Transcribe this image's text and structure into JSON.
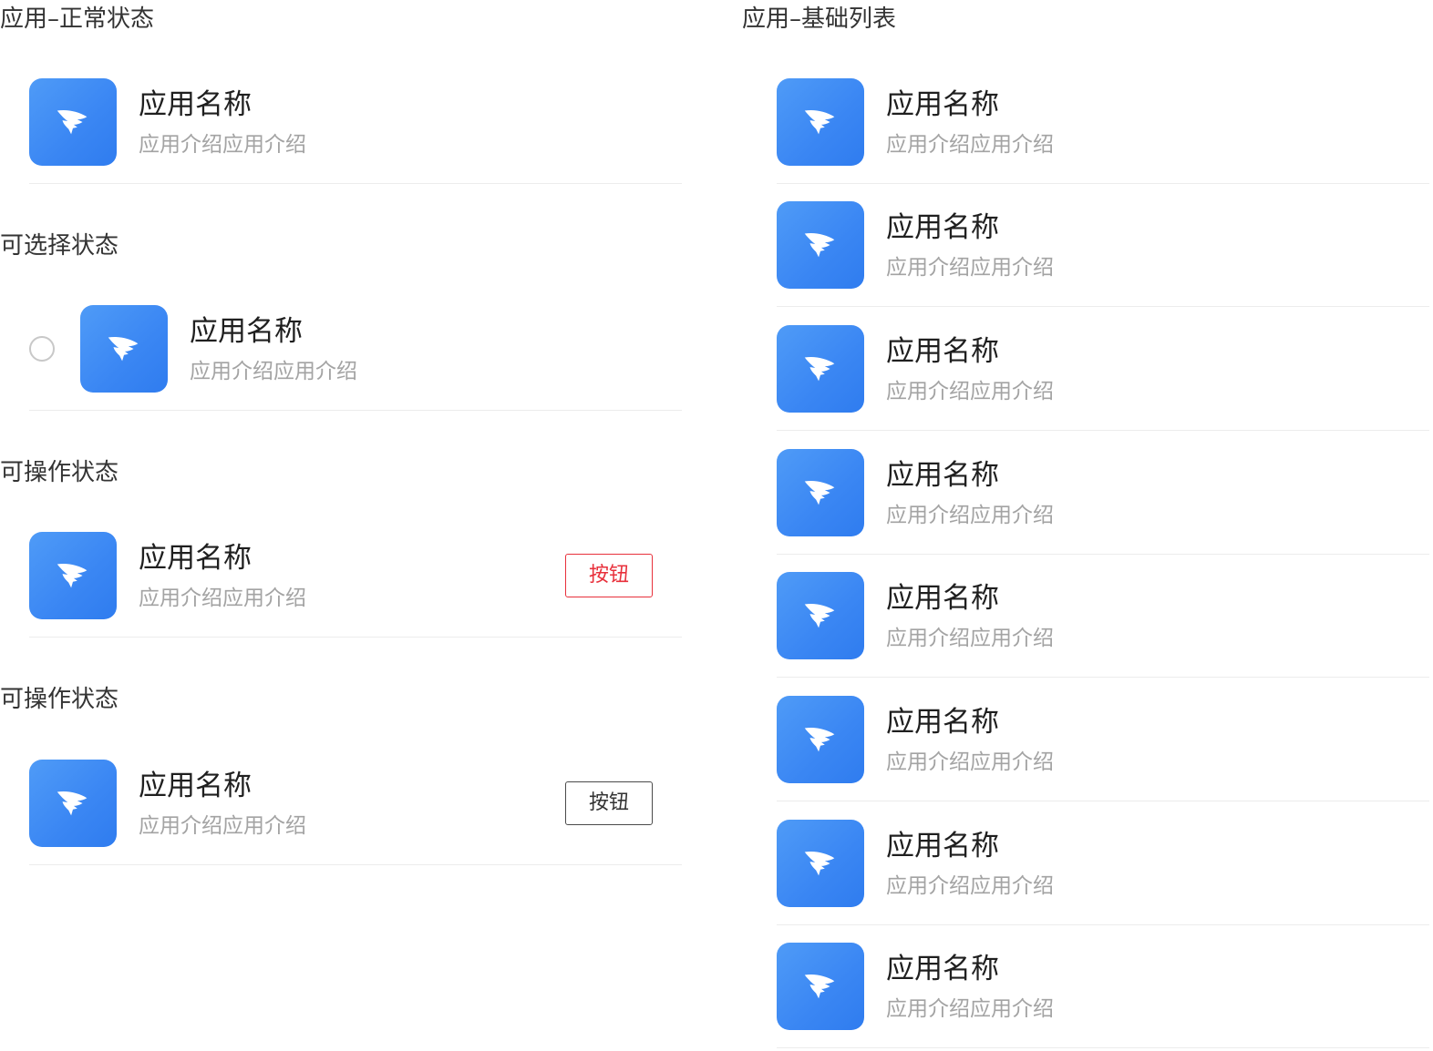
{
  "sections": {
    "normal_title": "应用–正常状态",
    "selectable_title": "可选择状态",
    "operable_red_title": "可操作状态",
    "operable_gray_title": "可操作状态",
    "basic_list_title": "应用–基础列表"
  },
  "item": {
    "name": "应用名称",
    "desc": "应用介绍应用介绍",
    "icon": "dingtalk-wing-icon"
  },
  "buttons": {
    "red_label": "按钮",
    "gray_label": "按钮"
  },
  "colors": {
    "icon_blue": "#3a86f3",
    "button_red": "#e8303b",
    "desc_gray": "#a3a3a3",
    "divider": "#ececec"
  },
  "basic_list": [
    {
      "name": "应用名称",
      "desc": "应用介绍应用介绍"
    },
    {
      "name": "应用名称",
      "desc": "应用介绍应用介绍"
    },
    {
      "name": "应用名称",
      "desc": "应用介绍应用介绍"
    },
    {
      "name": "应用名称",
      "desc": "应用介绍应用介绍"
    },
    {
      "name": "应用名称",
      "desc": "应用介绍应用介绍"
    },
    {
      "name": "应用名称",
      "desc": "应用介绍应用介绍"
    },
    {
      "name": "应用名称",
      "desc": "应用介绍应用介绍"
    },
    {
      "name": "应用名称",
      "desc": "应用介绍应用介绍"
    }
  ]
}
